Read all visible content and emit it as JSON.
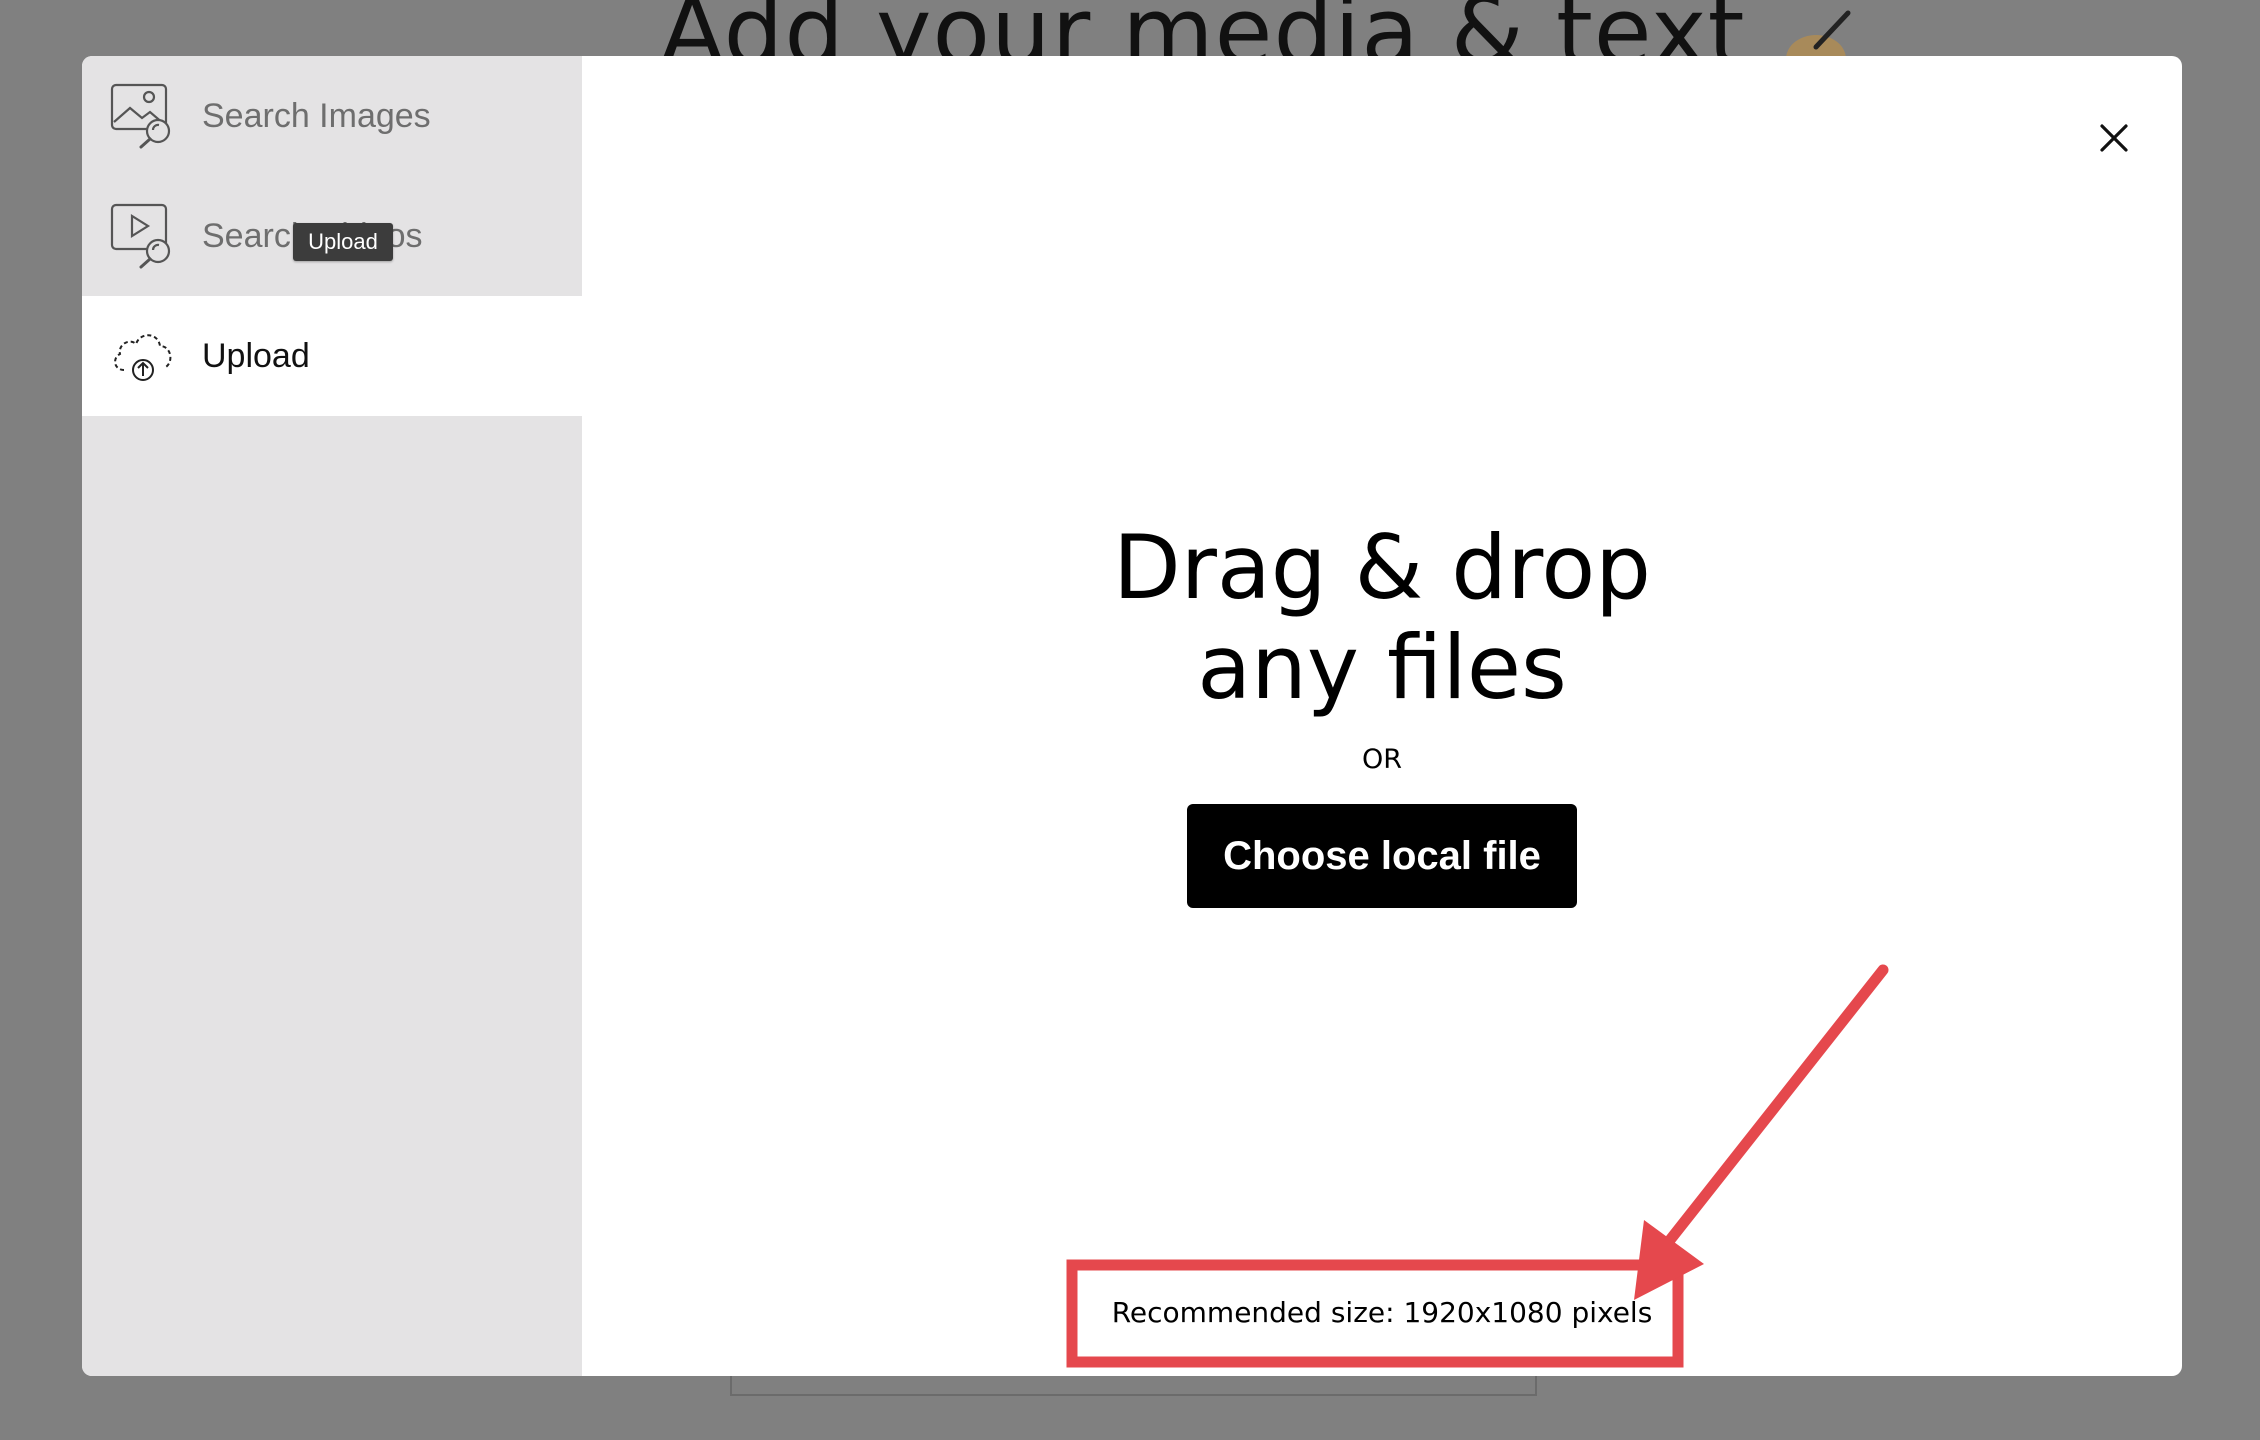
{
  "background": {
    "title": "Add your media & text"
  },
  "sidebar": {
    "items": [
      {
        "label": "Search Images",
        "icon": "search-images-icon",
        "active": false
      },
      {
        "label": "Search Videos",
        "icon": "search-videos-icon",
        "active": false
      },
      {
        "label": "Upload",
        "icon": "cloud-upload-icon",
        "active": true
      }
    ],
    "tooltip": "Upload"
  },
  "main": {
    "drop_title_line1": "Drag & drop",
    "drop_title_line2": "any files",
    "or_text": "OR",
    "choose_button": "Choose local file",
    "recommendation": "Recommended size: 1920x1080 pixels"
  },
  "colors": {
    "overlay": "#808080",
    "sidebar_bg": "#e4e3e4",
    "active_item_bg": "#ffffff",
    "button_bg": "#000000",
    "annotation_red": "#e5484d"
  },
  "icons": {
    "close": "close-icon",
    "annotation_arrow": "arrow-icon"
  }
}
